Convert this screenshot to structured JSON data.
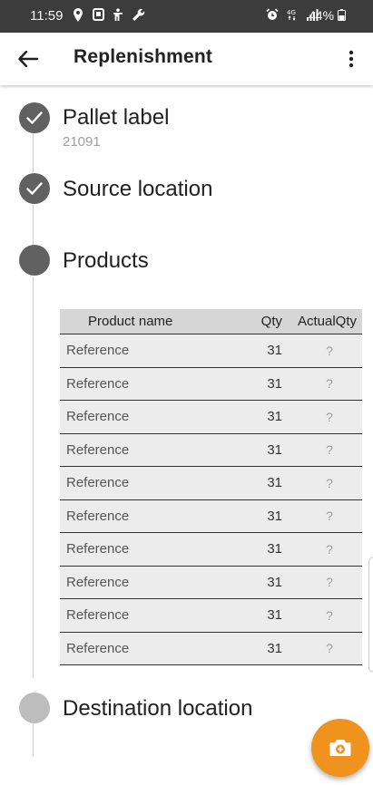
{
  "status_bar": {
    "time": "11:59",
    "battery": "44%",
    "icons_left": [
      "location-icon",
      "screenshot-icon",
      "accessibility-icon",
      "wrench-icon"
    ],
    "icons_right": [
      "alarm-icon",
      "4g-icon",
      "signal-icon"
    ]
  },
  "app_bar": {
    "title": "Replenishment",
    "back_icon": "arrow-back-icon",
    "menu_icon": "more-vert-icon"
  },
  "steps": [
    {
      "title": "Pallet label",
      "subtitle": "21091",
      "state": "done"
    },
    {
      "title": "Source location",
      "state": "done"
    },
    {
      "title": "Products",
      "state": "active"
    },
    {
      "title": "Destination location",
      "state": "pending"
    }
  ],
  "table": {
    "headers": {
      "name": "Product name",
      "qty": "Qty",
      "actual": "ActualQty"
    },
    "rows": [
      {
        "name": "Reference",
        "qty": "31",
        "actual": "?"
      },
      {
        "name": "Reference",
        "qty": "31",
        "actual": "?"
      },
      {
        "name": "Reference",
        "qty": "31",
        "actual": "?"
      },
      {
        "name": "Reference",
        "qty": "31",
        "actual": "?"
      },
      {
        "name": "Reference",
        "qty": "31",
        "actual": "?"
      },
      {
        "name": "Reference",
        "qty": "31",
        "actual": "?"
      },
      {
        "name": "Reference",
        "qty": "31",
        "actual": "?"
      },
      {
        "name": "Reference",
        "qty": "31",
        "actual": "?"
      },
      {
        "name": "Reference",
        "qty": "31",
        "actual": "?"
      },
      {
        "name": "Reference",
        "qty": "31",
        "actual": "?"
      }
    ]
  },
  "fab": {
    "icon": "camera-icon"
  },
  "colors": {
    "status_bar": "#3c3c3c",
    "step_done": "#616161",
    "step_active": "#616161",
    "step_pending": "#bdbdbd",
    "table_header": "#d6d6d6",
    "table_row": "#ececec",
    "fab": "#f0921e"
  }
}
